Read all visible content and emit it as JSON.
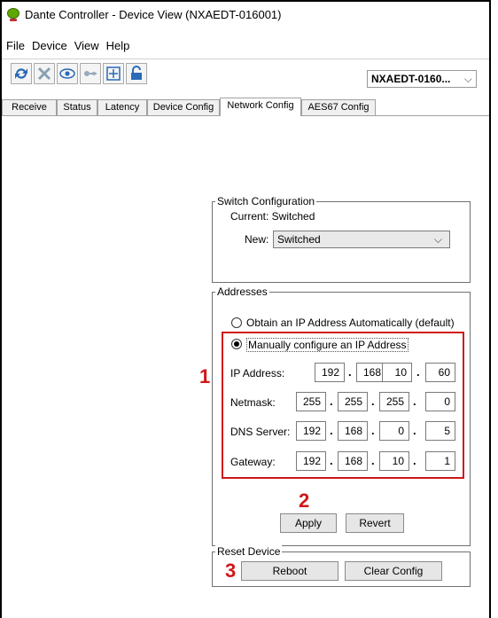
{
  "window": {
    "title": "Dante Controller - Device View (NXAEDT-016001)"
  },
  "menu": [
    "File",
    "Device",
    "View",
    "Help"
  ],
  "toolbar": {
    "device_select": "NXAEDT-0160..."
  },
  "tabs": [
    "Receive",
    "Status",
    "Latency",
    "Device Config",
    "Network Config",
    "AES67 Config"
  ],
  "active_tab": "Network Config",
  "switch_config": {
    "legend": "Switch Configuration",
    "current": "Current: Switched",
    "new_label": "New:",
    "new_value": "Switched"
  },
  "addresses": {
    "legend": "Addresses",
    "auto_label": "Obtain an IP Address Automatically (default)",
    "manual_label": "Manually configure an IP Address",
    "fields": [
      {
        "label": "IP Address:",
        "octets": [
          "192",
          "168",
          "10",
          "60"
        ]
      },
      {
        "label": "Netmask:",
        "octets": [
          "255",
          "255",
          "255",
          "0"
        ]
      },
      {
        "label": "DNS Server:",
        "octets": [
          "192",
          "168",
          "0",
          "5"
        ]
      },
      {
        "label": "Gateway:",
        "octets": [
          "192",
          "168",
          "10",
          "1"
        ]
      }
    ],
    "apply_label": "Apply",
    "revert_label": "Revert"
  },
  "reset": {
    "legend": "Reset Device",
    "reboot_label": "Reboot",
    "clear_label": "Clear Config"
  },
  "annotations": [
    "1",
    "2",
    "3"
  ],
  "colors": {
    "annotation": "#d01818",
    "ok_icon": "#5fa800"
  }
}
